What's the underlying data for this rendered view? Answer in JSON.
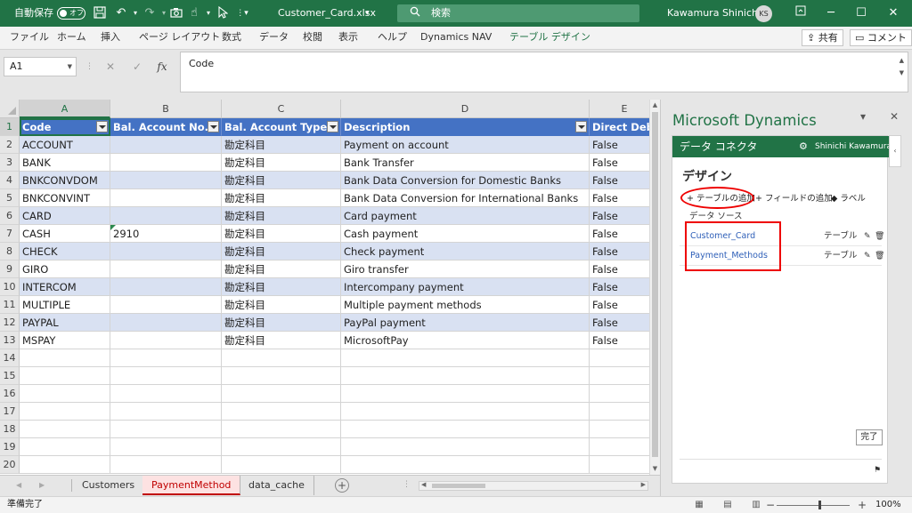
{
  "titlebar": {
    "autosave_label": "自動保存",
    "autosave_state": "オフ",
    "filename": "Customer_Card.xlsx",
    "filename_caret": "▾",
    "search_placeholder": "検索",
    "user_name": "Kawamura Shinichi",
    "user_initials": "KS",
    "icons": [
      "save-icon",
      "undo-icon",
      "redo-icon",
      "camera-icon",
      "touch-icon",
      "pointer-icon",
      "customize-icon",
      "ribbon-options-icon",
      "minimize-icon",
      "restore-icon",
      "close-icon"
    ]
  },
  "ribbon": {
    "tabs": [
      "ファイル",
      "ホーム",
      "挿入",
      "ページ レイアウト",
      "数式",
      "データ",
      "校閲",
      "表示",
      "ヘルプ",
      "Dynamics NAV",
      "テーブル デザイン"
    ],
    "active_tab": "テーブル デザイン",
    "share_label": "共有",
    "comment_label": "コメント"
  },
  "formula": {
    "name_box": "A1",
    "cancel_symbol": "✕",
    "enter_symbol": "✓",
    "fx_symbol": "fx",
    "value": "Code"
  },
  "grid": {
    "columns": [
      "A",
      "B",
      "C",
      "D",
      "E"
    ],
    "selected_column": "A",
    "header": [
      "Code",
      "Bal. Account No.",
      "Bal. Account Type",
      "Description",
      "Direct Debit"
    ],
    "rows": [
      [
        "ACCOUNT",
        "",
        "勘定科目",
        "Payment on account",
        "False"
      ],
      [
        "BANK",
        "",
        "勘定科目",
        "Bank Transfer",
        "False"
      ],
      [
        "BNKCONVDOM",
        "",
        "勘定科目",
        "Bank Data Conversion for Domestic Banks",
        "False"
      ],
      [
        "BNKCONVINT",
        "",
        "勘定科目",
        "Bank Data Conversion for International Banks",
        "False"
      ],
      [
        "CARD",
        "",
        "勘定科目",
        "Card payment",
        "False"
      ],
      [
        "CASH",
        "2910",
        "勘定科目",
        "Cash payment",
        "False"
      ],
      [
        "CHECK",
        "",
        "勘定科目",
        "Check payment",
        "False"
      ],
      [
        "GIRO",
        "",
        "勘定科目",
        "Giro transfer",
        "False"
      ],
      [
        "INTERCOM",
        "",
        "勘定科目",
        "Intercompany payment",
        "False"
      ],
      [
        "MULTIPLE",
        "",
        "勘定科目",
        "Multiple payment methods",
        "False"
      ],
      [
        "PAYPAL",
        "",
        "勘定科目",
        "PayPal payment",
        "False"
      ],
      [
        "MSPAY",
        "",
        "勘定科目",
        "MicrosoftPay",
        "False"
      ]
    ],
    "row_numbers": [
      "1",
      "2",
      "3",
      "4",
      "5",
      "6",
      "7",
      "8",
      "9",
      "10",
      "11",
      "12",
      "13",
      "14",
      "15",
      "16",
      "17",
      "18",
      "19",
      "20"
    ],
    "table_header_color": "#4472c4",
    "band_color": "#d9e1f2"
  },
  "sheets": {
    "tabs": [
      "Customers",
      "PaymentMethod",
      "data_cache"
    ],
    "active": "PaymentMethod",
    "add_symbol": "+"
  },
  "status": {
    "ready": "準備完了",
    "zoom": "100%"
  },
  "pane": {
    "title": "Microsoft Dynamics",
    "header_title": "データ コネクタ",
    "header_user": "Shinichi Kawamura",
    "design_heading": "デザイン",
    "add_table": "テーブルの追加",
    "add_field": "フィールドの追加",
    "label": "ラベル",
    "datasource_label": "データ ソース",
    "datasources": [
      {
        "name": "Customer_Card",
        "type": "テーブル"
      },
      {
        "name": "Payment_Methods",
        "type": "テーブル"
      }
    ],
    "done": "完了",
    "accent_color": "#217346",
    "highlight_color": "#e00000"
  }
}
